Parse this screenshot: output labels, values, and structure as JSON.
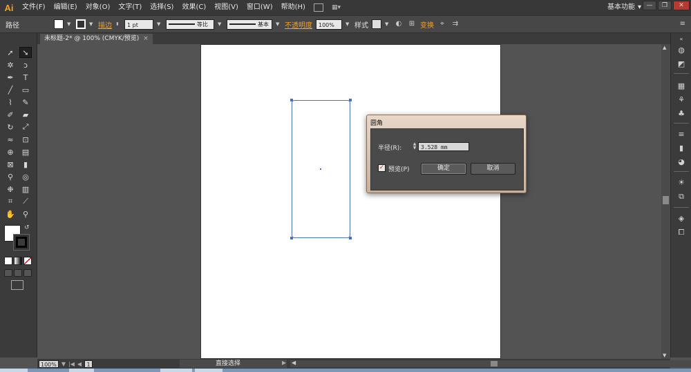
{
  "app": {
    "logo": "Ai"
  },
  "menu": [
    {
      "label": "文件(F)",
      "name": "menu-file"
    },
    {
      "label": "编辑(E)",
      "name": "menu-edit"
    },
    {
      "label": "对象(O)",
      "name": "menu-object"
    },
    {
      "label": "文字(T)",
      "name": "menu-type"
    },
    {
      "label": "选择(S)",
      "name": "menu-select"
    },
    {
      "label": "效果(C)",
      "name": "menu-effect"
    },
    {
      "label": "视图(V)",
      "name": "menu-view"
    },
    {
      "label": "窗口(W)",
      "name": "menu-window"
    },
    {
      "label": "帮助(H)",
      "name": "menu-help"
    }
  ],
  "workspace": {
    "label": "基本功能",
    "arrow": "▾"
  },
  "window_buttons": {
    "minimize": "—",
    "maximize": "❐",
    "close": "✕"
  },
  "controlbar": {
    "object_type": "路径",
    "stroke_label": "描边",
    "stroke_weight": "1 pt",
    "profile_label": "等比",
    "brush_label": "基本",
    "opacity_label": "不透明度",
    "opacity_value": "100%",
    "style_label": "样式",
    "transform_label": "变换"
  },
  "document_tab": {
    "title": "未标题-2* @ 100% (CMYK/预览)",
    "close": "×"
  },
  "dialog": {
    "title": "圆角",
    "radius_label": "半径(R):",
    "radius_value": "3.528 mm",
    "preview_label": "预览(P)",
    "preview_checked": "✓",
    "ok_label": "确定",
    "cancel_label": "取消"
  },
  "statusbar": {
    "zoom": "100%",
    "page": "1",
    "status": "直接选择"
  },
  "colors": {
    "accent": "#f0a030",
    "selection": "#4a72b0",
    "panel": "#3b3b3b",
    "background": "#535353"
  }
}
